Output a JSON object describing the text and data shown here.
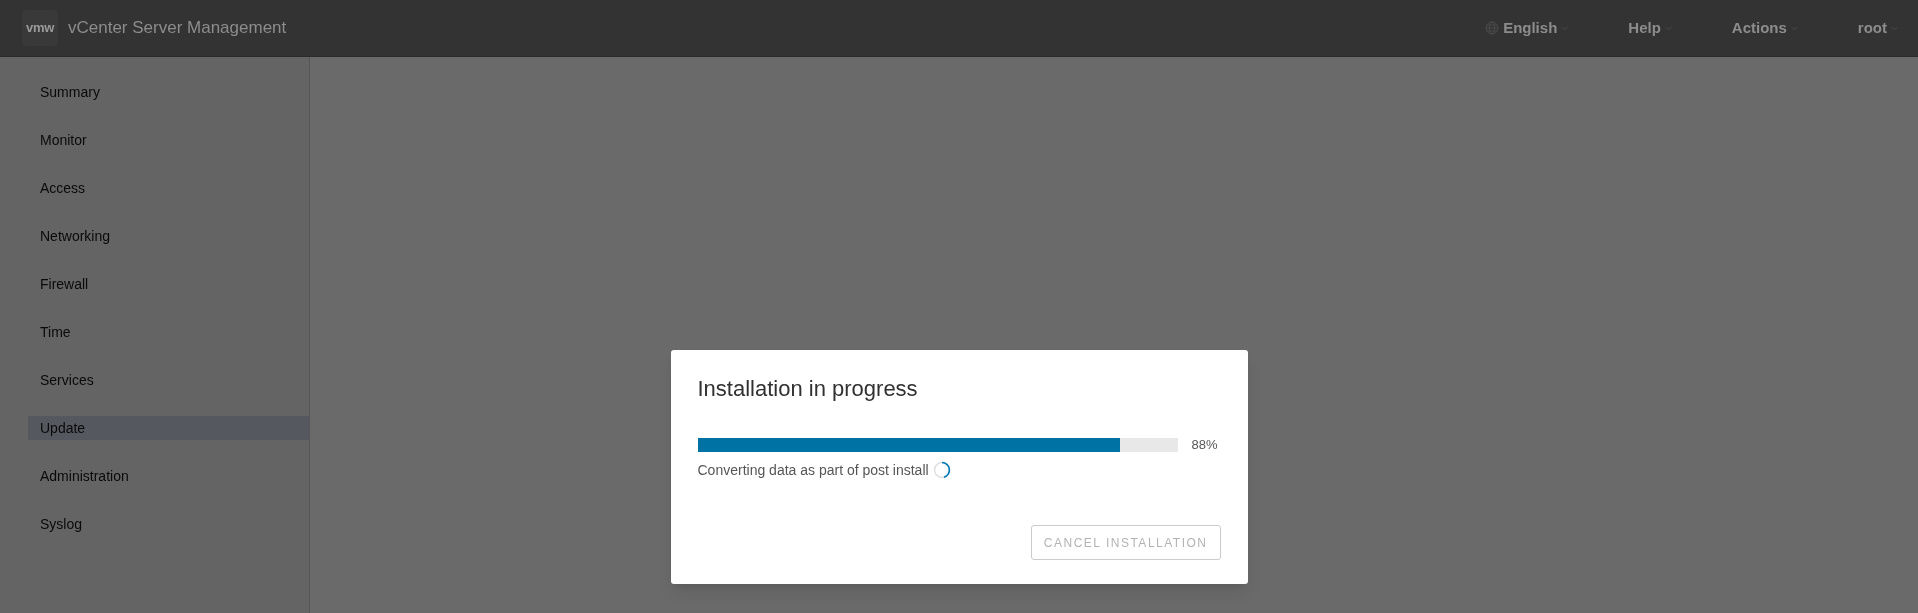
{
  "header": {
    "logo": "vmw",
    "title": "vCenter Server Management",
    "menus": [
      {
        "label": "English",
        "kind": "language"
      },
      {
        "label": "Help",
        "kind": "menu"
      },
      {
        "label": "Actions",
        "kind": "menu"
      },
      {
        "label": "root",
        "kind": "menu"
      }
    ]
  },
  "sidebar": {
    "items": [
      {
        "label": "Summary",
        "selected": false
      },
      {
        "label": "Monitor",
        "selected": false
      },
      {
        "label": "Access",
        "selected": false
      },
      {
        "label": "Networking",
        "selected": false
      },
      {
        "label": "Firewall",
        "selected": false
      },
      {
        "label": "Time",
        "selected": false
      },
      {
        "label": "Services",
        "selected": false
      },
      {
        "label": "Update",
        "selected": true
      },
      {
        "label": "Administration",
        "selected": false
      },
      {
        "label": "Syslog",
        "selected": false
      }
    ]
  },
  "dialog": {
    "title": "Installation in progress",
    "progress": {
      "level": 0.88,
      "reading": "88%"
    },
    "status": "Converting data as part of post install",
    "button": {
      "label": "CANCEL INSTALLATION",
      "disabled": true
    }
  }
}
